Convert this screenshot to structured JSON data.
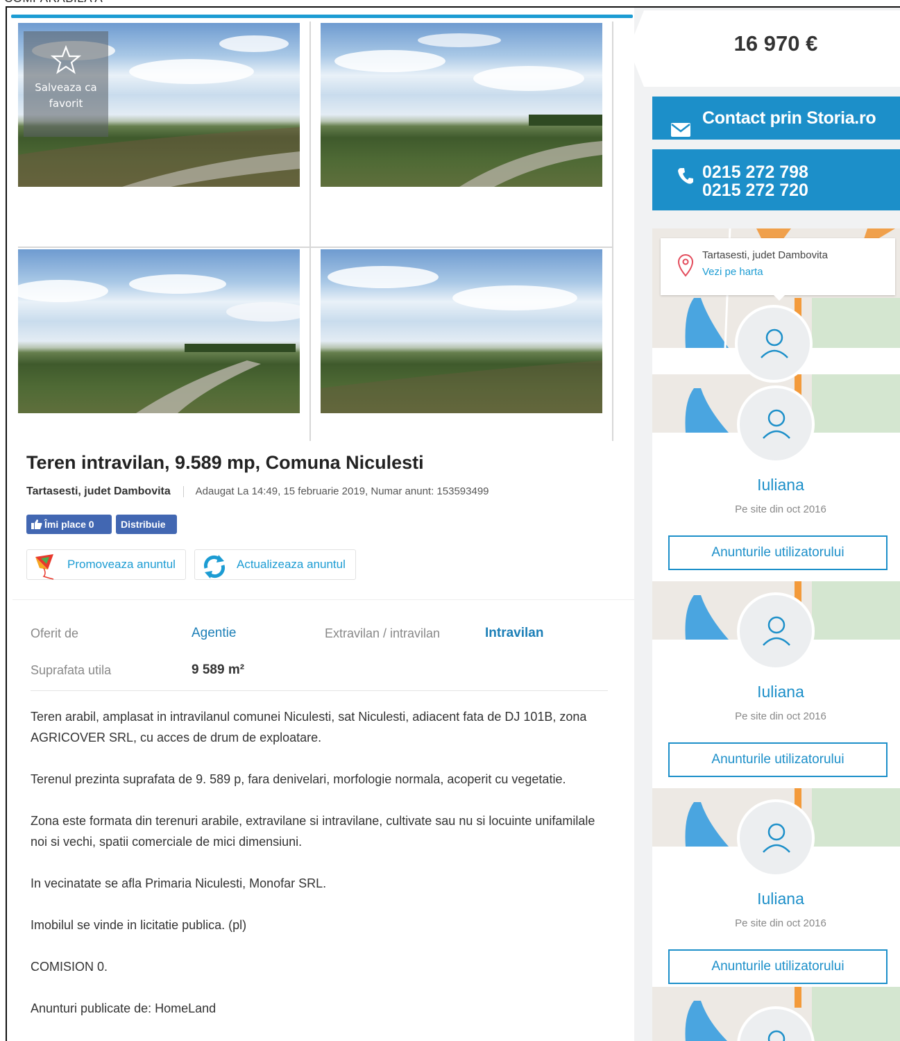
{
  "document": {
    "heading": "COMPARABILA A"
  },
  "gallery": {
    "favorite_label": "Salveaza ca favorit",
    "photos": [
      "photo-1",
      "photo-2",
      "photo-3",
      "photo-4"
    ]
  },
  "listing": {
    "title": "Teren intravilan, 9.589 mp, Comuna Niculesti",
    "location": "Tartasesti, judet Dambovita",
    "added": "Adaugat La 14:49, 15 februarie 2019, Numar anunt: 153593499",
    "like_label": "Îmi place 0",
    "share_label": "Distribuie",
    "promote_label": "Promoveaza anuntul",
    "update_label": "Actualizeaza anuntul"
  },
  "params": {
    "offered_by_label": "Oferit de",
    "offered_by_value": "Agentie",
    "extravilan_label": "Extravilan / intravilan",
    "extravilan_value": "Intravilan",
    "area_label": "Suprafata utila",
    "area_value": "9 589 m²"
  },
  "description": [
    "Teren arabil, amplasat in intravilanul comunei Niculesti, sat Niculesti, adiacent fata de DJ 101B, zona AGRICOVER SRL, cu acces de drum de exploatare.",
    "Terenul prezinta suprafata de 9. 589 p, fara denivelari, morfologie normala, acoperit cu vegetatie.",
    "Zona este formata din terenuri arabile, extravilane si intravilane, cultivate sau nu si locuinte unifamilale noi si vechi, spatii comerciale de mici dimensiuni.",
    "In vecinatate se afla Primaria Niculesti, Monofar SRL.",
    "Imobilul se vinde in licitatie publica. (pl)",
    "COMISION 0.",
    "Anunturi publicate de: HomeLand"
  ],
  "sidebar": {
    "price": "16 970 €",
    "contact_label": "Contact prin Storia.ro",
    "phones": [
      "0215 272 798",
      "0215 272 720"
    ],
    "map_location": "Tartasesti, judet Dambovita",
    "map_link": "Vezi pe harta",
    "agents": [
      {
        "name": "Iuliana",
        "since": "Pe site din oct 2016",
        "button": "Anunturile utilizatorului"
      },
      {
        "name": "Iuliana",
        "since": "Pe site din oct 2016",
        "button": "Anunturile utilizatorului"
      },
      {
        "name": "Iuliana",
        "since": "Pe site din oct 2016",
        "button": "Anunturile utilizatorului"
      }
    ]
  },
  "colors": {
    "accent": "#1c9cd3",
    "button_blue": "#1c8fc9",
    "facebook": "#4267b2"
  }
}
